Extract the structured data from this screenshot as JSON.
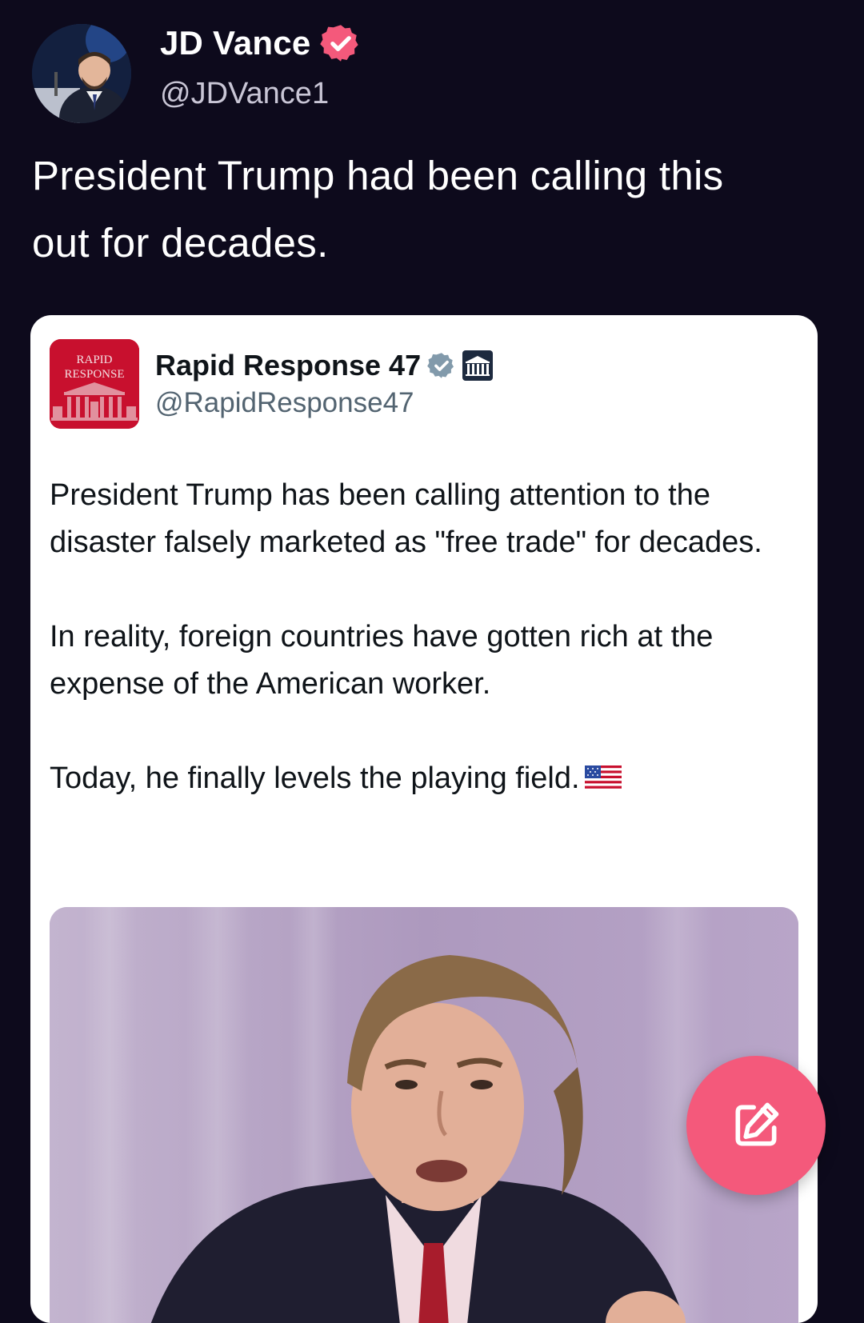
{
  "post": {
    "author_name": "JD Vance",
    "author_handle": "@JDVance1",
    "author_avatar_icon": "profile-photo",
    "verified_icon": "verified-badge-icon",
    "verified_color": "#f4597b",
    "text_line1": "President Trump had been calling this",
    "text_line2": "out for decades."
  },
  "quoted_post": {
    "author_name": "Rapid Response 47",
    "author_handle": "@RapidResponse47",
    "logo": {
      "line1": "RAPID",
      "line2": "RESPONSE",
      "color": "#c8102e"
    },
    "verified_icon": "verified-badge-icon",
    "verified_color": "#829aab",
    "affiliation_icon": "white-house-icon",
    "paragraph1": "President Trump has been calling attention to the disaster falsely marketed as \"free trade\" for decades.",
    "paragraph2": "In reality, foreign countries have gotten rich at the expense of the American worker.",
    "paragraph3": "Today, he finally levels the playing field.",
    "emoji": "us-flag-emoji",
    "media": "video-thumbnail"
  },
  "compose_button": {
    "icon": "compose-icon",
    "color": "#f4597b"
  }
}
